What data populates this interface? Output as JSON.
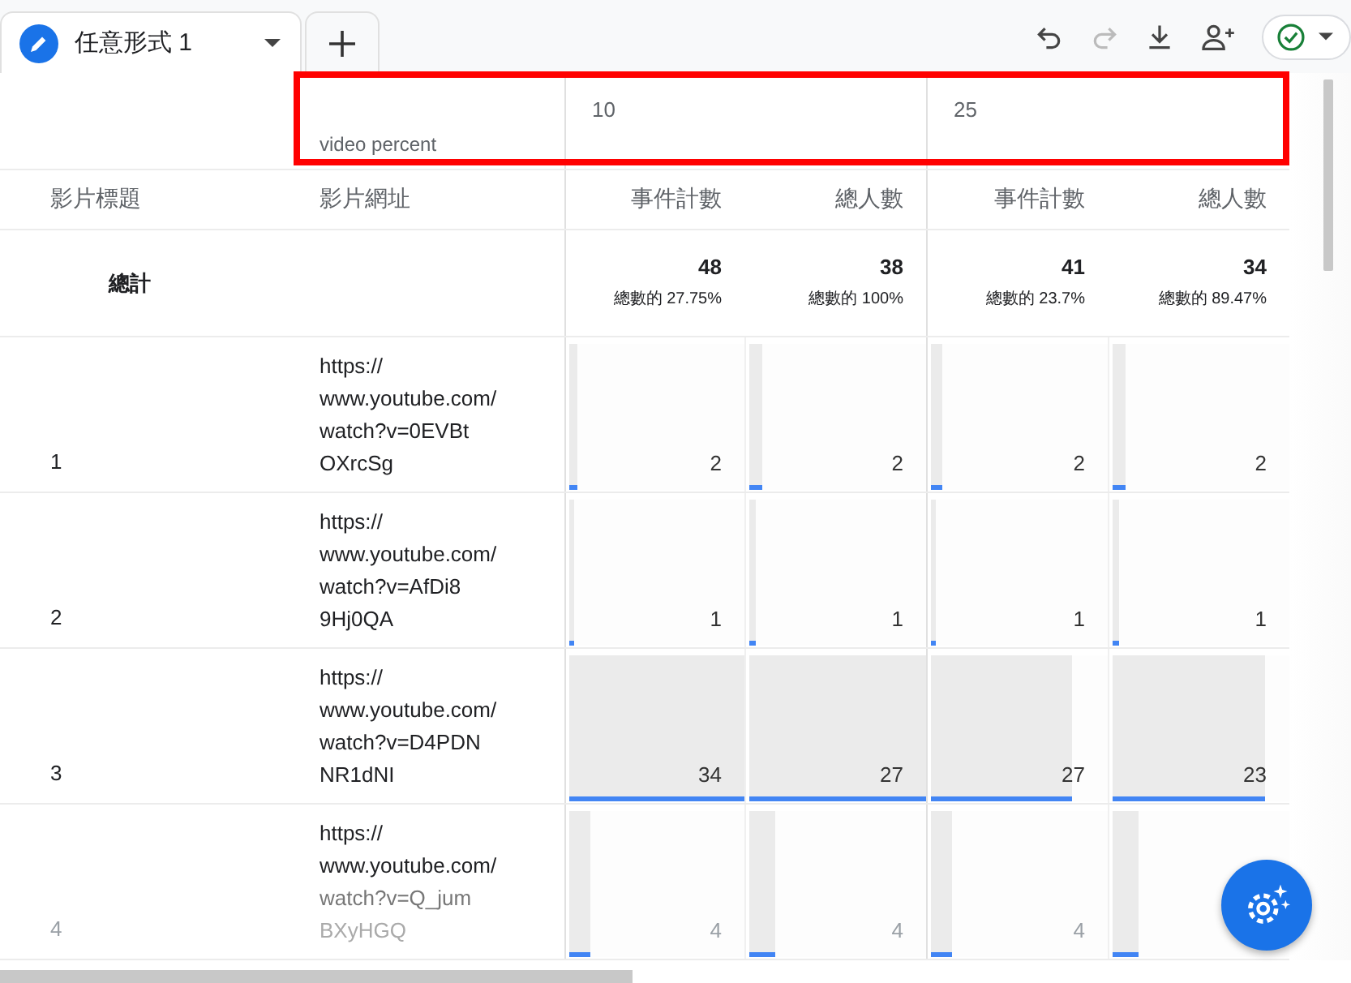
{
  "tabs": [
    {
      "label": "任意形式 1",
      "selected": true
    }
  ],
  "toolbar": {
    "redo_disabled": true
  },
  "pivot": {
    "label": "video percent",
    "highlighted": true,
    "groups": [
      "10",
      "25"
    ]
  },
  "columns": [
    "影片標題",
    "影片網址",
    "事件計數",
    "總人數",
    "事件計數",
    "總人數"
  ],
  "totals": {
    "label": "總計",
    "cells": [
      {
        "value": "48",
        "share": "總數的 27.75%"
      },
      {
        "value": "38",
        "share": "總數的 100%"
      },
      {
        "value": "41",
        "share": "總數的 23.7%"
      },
      {
        "value": "34",
        "share": "總數的 89.47%"
      }
    ]
  },
  "rows": [
    {
      "title": "1",
      "url_lines": [
        "https://",
        "www.youtube.com/",
        "watch?v=0EVBt",
        "OXrcSg"
      ],
      "cells": [
        {
          "value": "2",
          "level": 0.05
        },
        {
          "value": "2",
          "level": 0.07
        },
        {
          "value": "2",
          "level": 0.06
        },
        {
          "value": "2",
          "level": 0.07
        }
      ]
    },
    {
      "title": "2",
      "url_lines": [
        "https://",
        "www.youtube.com/",
        "watch?v=AfDi8",
        "9Hj0QA"
      ],
      "cells": [
        {
          "value": "1",
          "level": 0.03
        },
        {
          "value": "1",
          "level": 0.04
        },
        {
          "value": "1",
          "level": 0.03
        },
        {
          "value": "1",
          "level": 0.04
        }
      ]
    },
    {
      "title": "3",
      "url_lines": [
        "https://",
        "www.youtube.com/",
        "watch?v=D4PDN",
        "NR1dNI"
      ],
      "cells": [
        {
          "value": "34",
          "level": 1.0
        },
        {
          "value": "27",
          "level": 1.0
        },
        {
          "value": "27",
          "level": 0.8
        },
        {
          "value": "23",
          "level": 0.86
        }
      ]
    },
    {
      "title": "4",
      "url_lines": [
        "https://",
        "www.youtube.com/",
        "watch?v=Q_jum",
        "BXyHGQ"
      ],
      "cells": [
        {
          "value": "4",
          "level": 0.12
        },
        {
          "value": "4",
          "level": 0.15
        },
        {
          "value": "4",
          "level": 0.12
        },
        {
          "level": 0.15
        }
      ]
    }
  ]
}
